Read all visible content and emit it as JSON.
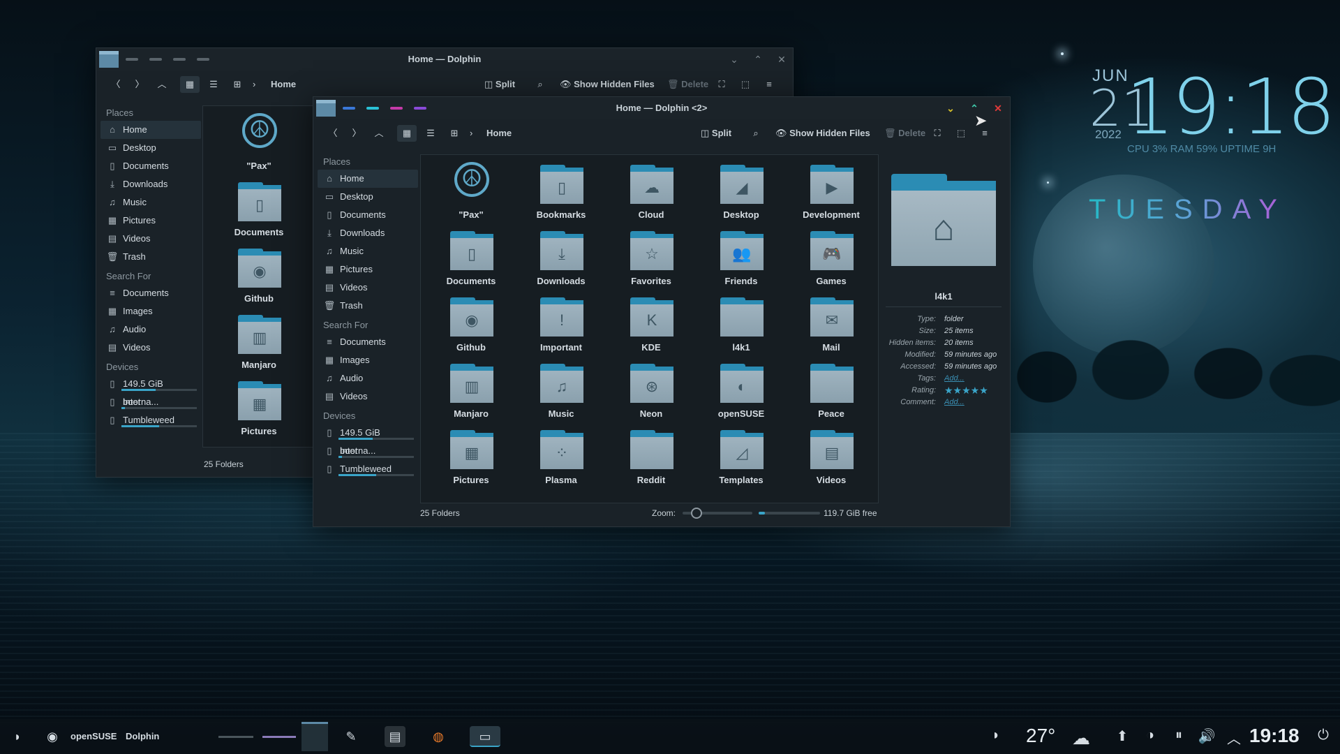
{
  "desktop": {
    "clock": {
      "month": "JUN",
      "day": "21",
      "time": "19:18",
      "year": "2022",
      "stats": "CPU 3% RAM 59% UPTIME 9H",
      "weekday": "TUESDAY"
    }
  },
  "win1": {
    "title": "Home — Dolphin",
    "location": "Home",
    "toolbar": {
      "split": "Split",
      "hidden": "Show Hidden Files",
      "delete": "Delete"
    },
    "places_header": "Places",
    "places": [
      {
        "label": "Home",
        "icon": "⌂"
      },
      {
        "label": "Desktop",
        "icon": "▭"
      },
      {
        "label": "Documents",
        "icon": "▯"
      },
      {
        "label": "Downloads",
        "icon": "⤓"
      },
      {
        "label": "Music",
        "icon": "♫"
      },
      {
        "label": "Pictures",
        "icon": "▦"
      },
      {
        "label": "Videos",
        "icon": "▤"
      },
      {
        "label": "Trash",
        "icon": "🗑"
      }
    ],
    "search_header": "Search For",
    "search": [
      {
        "label": "Documents",
        "icon": "≡"
      },
      {
        "label": "Images",
        "icon": "▦"
      },
      {
        "label": "Audio",
        "icon": "♫"
      },
      {
        "label": "Videos",
        "icon": "▤"
      }
    ],
    "devices_header": "Devices",
    "devices": [
      {
        "label": "149.5 GiB Interna...",
        "icon": "▯",
        "used": 0.45
      },
      {
        "label": "boot",
        "icon": "▯",
        "used": 0.05
      },
      {
        "label": "Tumbleweed",
        "icon": "▯",
        "used": 0.5
      }
    ],
    "files": [
      {
        "label": "\"Pax\"",
        "icon": "☮"
      },
      {
        "label": "Documents",
        "icon": "▯"
      },
      {
        "label": "Github",
        "icon": "◉"
      },
      {
        "label": "Manjaro",
        "icon": "▥"
      },
      {
        "label": "Pictures",
        "icon": "▦"
      }
    ],
    "status": "25 Folders"
  },
  "win2": {
    "title": "Home — Dolphin <2>",
    "location": "Home",
    "toolbar": {
      "split": "Split",
      "hidden": "Show Hidden Files",
      "delete": "Delete"
    },
    "places_header": "Places",
    "places": [
      {
        "label": "Home",
        "icon": "⌂"
      },
      {
        "label": "Desktop",
        "icon": "▭"
      },
      {
        "label": "Documents",
        "icon": "▯"
      },
      {
        "label": "Downloads",
        "icon": "⤓"
      },
      {
        "label": "Music",
        "icon": "♫"
      },
      {
        "label": "Pictures",
        "icon": "▦"
      },
      {
        "label": "Videos",
        "icon": "▤"
      },
      {
        "label": "Trash",
        "icon": "🗑"
      }
    ],
    "search_header": "Search For",
    "search": [
      {
        "label": "Documents",
        "icon": "≡"
      },
      {
        "label": "Images",
        "icon": "▦"
      },
      {
        "label": "Audio",
        "icon": "♫"
      },
      {
        "label": "Videos",
        "icon": "▤"
      }
    ],
    "devices_header": "Devices",
    "devices": [
      {
        "label": "149.5 GiB Interna...",
        "icon": "▯",
        "used": 0.45
      },
      {
        "label": "boot",
        "icon": "▯",
        "used": 0.05
      },
      {
        "label": "Tumbleweed",
        "icon": "▯",
        "used": 0.5
      }
    ],
    "files": [
      {
        "label": "\"Pax\"",
        "icon": "☮"
      },
      {
        "label": "Bookmarks",
        "icon": "▯"
      },
      {
        "label": "Cloud",
        "icon": "☁"
      },
      {
        "label": "Desktop",
        "icon": "◢"
      },
      {
        "label": "Development",
        "icon": "▶"
      },
      {
        "label": "Documents",
        "icon": "▯"
      },
      {
        "label": "Downloads",
        "icon": "⤓"
      },
      {
        "label": "Favorites",
        "icon": "☆"
      },
      {
        "label": "Friends",
        "icon": "👥"
      },
      {
        "label": "Games",
        "icon": "🎮"
      },
      {
        "label": "Github",
        "icon": "◉"
      },
      {
        "label": "Important",
        "icon": "!"
      },
      {
        "label": "KDE",
        "icon": "K"
      },
      {
        "label": "l4k1",
        "icon": ""
      },
      {
        "label": "Mail",
        "icon": "✉"
      },
      {
        "label": "Manjaro",
        "icon": "▥"
      },
      {
        "label": "Music",
        "icon": "♫"
      },
      {
        "label": "Neon",
        "icon": "⊛"
      },
      {
        "label": "openSUSE",
        "icon": "◐"
      },
      {
        "label": "Peace",
        "icon": ""
      },
      {
        "label": "Pictures",
        "icon": "▦"
      },
      {
        "label": "Plasma",
        "icon": "⁘"
      },
      {
        "label": "Reddit",
        "icon": ""
      },
      {
        "label": "Templates",
        "icon": "◿"
      },
      {
        "label": "Videos",
        "icon": "▤"
      }
    ],
    "status": "25 Folders",
    "zoom_label": "Zoom:",
    "zoom_level": 0.2,
    "disk_used": 0.1,
    "free": "119.7 GiB free",
    "info": {
      "name": "l4k1",
      "rows": [
        {
          "k": "Type:",
          "v": "folder"
        },
        {
          "k": "Size:",
          "v": "25 items"
        },
        {
          "k": "Hidden items:",
          "v": "20 items"
        },
        {
          "k": "Modified:",
          "v": "59 minutes ago"
        },
        {
          "k": "Accessed:",
          "v": "59 minutes ago"
        },
        {
          "k": "Tags:",
          "v": "Add..."
        },
        {
          "k": "Rating:",
          "v": "★★★★★"
        },
        {
          "k": "Comment:",
          "v": "Add..."
        }
      ]
    }
  },
  "taskbar": {
    "distro": "openSUSE",
    "app": "Dolphin",
    "temperature": "27°",
    "clock": "19:18"
  },
  "colors": {
    "accent": "#2b8cb4",
    "close": "#e03a3a",
    "minimize": "#d8c22a",
    "maximize": "#3ec7a8"
  }
}
